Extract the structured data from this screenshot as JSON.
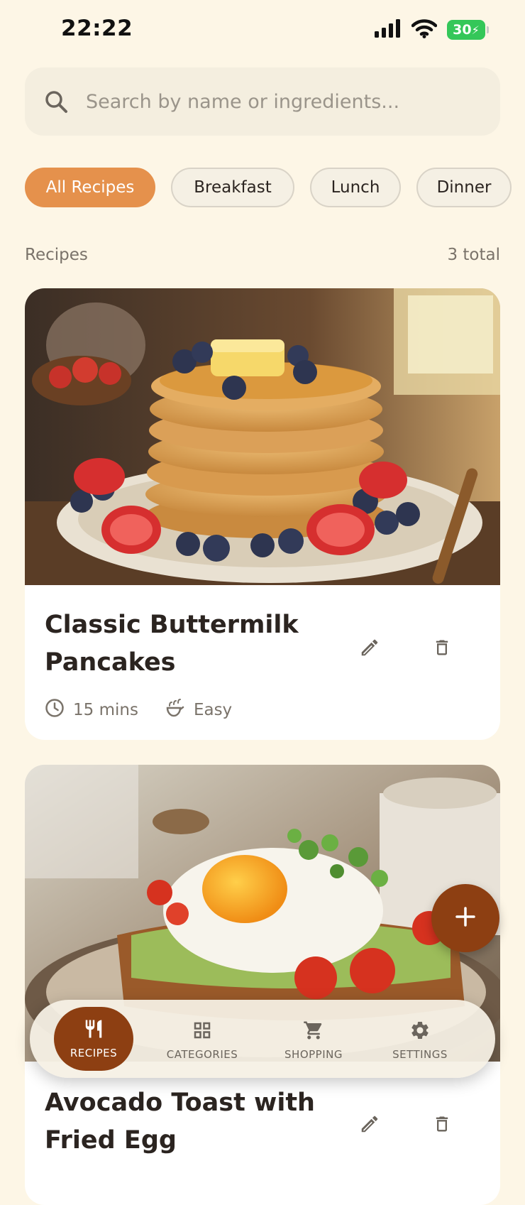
{
  "status": {
    "time": "22:22",
    "battery": "30"
  },
  "search": {
    "placeholder": "Search by name or ingredients..."
  },
  "filters": [
    {
      "label": "All Recipes",
      "active": true
    },
    {
      "label": "Breakfast",
      "active": false
    },
    {
      "label": "Lunch",
      "active": false
    },
    {
      "label": "Dinner",
      "active": false
    }
  ],
  "section": {
    "title": "Recipes",
    "count": "3 total"
  },
  "recipes": [
    {
      "title": "Classic Buttermilk Pancakes",
      "time": "15 mins",
      "difficulty": "Easy"
    },
    {
      "title": "Avocado Toast with Fried Egg"
    }
  ],
  "nav": {
    "recipes": "RECIPES",
    "categories": "CATEGORIES",
    "shopping": "SHOPPING",
    "settings": "SETTINGS"
  },
  "colors": {
    "accent": "#e5914c",
    "brand": "#8d3f12",
    "background": "#fdf6e6"
  }
}
